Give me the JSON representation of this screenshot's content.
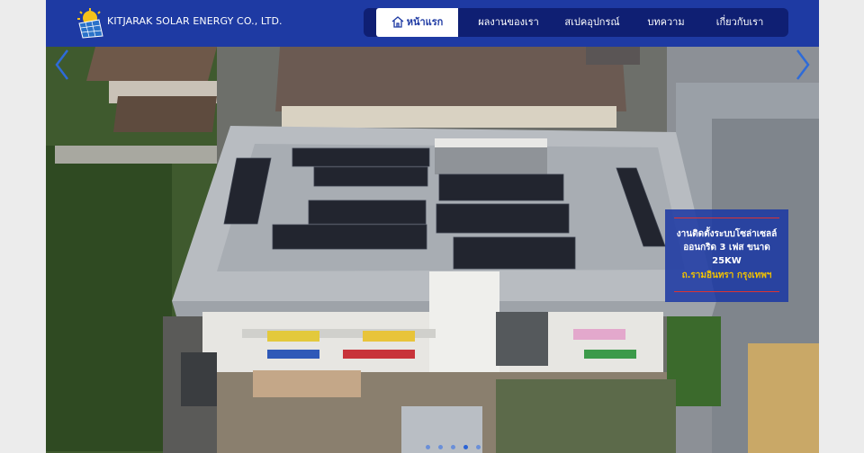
{
  "header": {
    "company_name": "KITJARAK SOLAR ENERGY CO., LTD.",
    "logo_icon": "solar-panel-sun-logo"
  },
  "nav": {
    "items": [
      {
        "label": "หน้าแรก",
        "active": true,
        "icon": "home-icon"
      },
      {
        "label": "ผลงานของเรา",
        "active": false
      },
      {
        "label": "สเปคอุปกรณ์",
        "active": false
      },
      {
        "label": "บทความ",
        "active": false
      },
      {
        "label": "เกี่ยวกับเรา",
        "active": false
      }
    ]
  },
  "slider": {
    "caption_line1": "งานติดตั้งระบบโซล่าเซลล์",
    "caption_line2": "ออนกริด 3 เฟส ขนาด",
    "caption_line3": "25KW",
    "caption_location": "ถ.รามอินทรา กรุงเทพฯ",
    "prev_icon": "chevron-left-icon",
    "next_icon": "chevron-right-icon",
    "slide_count": 5,
    "active_slide": 3
  },
  "colors": {
    "header_bg": "#1e3aa3",
    "nav_bg": "#0f1f73",
    "caption_bg": "#1e3aa3",
    "caption_accent": "#f2c200"
  }
}
